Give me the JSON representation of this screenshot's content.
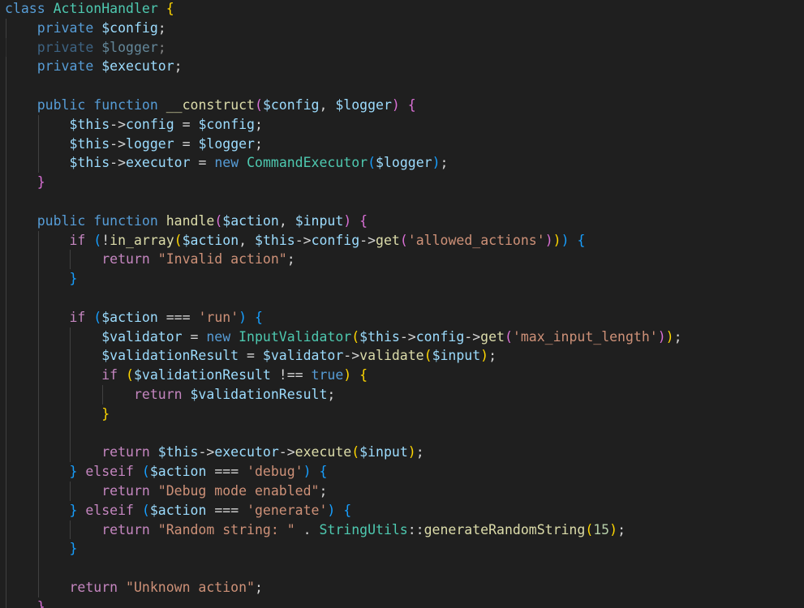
{
  "theme": {
    "background": "#1f1f1f",
    "keyword": "#569cd6",
    "control": "#c586c0",
    "class_name": "#4ec9b0",
    "function_name": "#dcdcaa",
    "variable": "#9cdcfe",
    "string": "#ce9178",
    "number": "#b5cea8",
    "punctuation": "#d4d4d4",
    "bracket_1": "#ffd700",
    "bracket_2": "#da70d6",
    "bracket_3": "#179fff"
  },
  "code": {
    "lines": [
      {
        "indent": 0,
        "tokens": [
          [
            "class",
            "kw"
          ],
          [
            " ",
            "pun"
          ],
          [
            "ActionHandler",
            "cls"
          ],
          [
            " ",
            "pun"
          ],
          [
            "{",
            "b1"
          ]
        ]
      },
      {
        "indent": 1,
        "tokens": [
          [
            "private",
            "kw"
          ],
          [
            " ",
            "pun"
          ],
          [
            "$config",
            "var"
          ],
          [
            ";",
            "pun"
          ]
        ]
      },
      {
        "indent": 1,
        "dim": true,
        "tokens": [
          [
            "private",
            "kw"
          ],
          [
            " ",
            "pun"
          ],
          [
            "$logger",
            "var"
          ],
          [
            ";",
            "pun"
          ]
        ]
      },
      {
        "indent": 1,
        "tokens": [
          [
            "private",
            "kw"
          ],
          [
            " ",
            "pun"
          ],
          [
            "$executor",
            "var"
          ],
          [
            ";",
            "pun"
          ]
        ]
      },
      {
        "indent": 1,
        "tokens": []
      },
      {
        "indent": 1,
        "tokens": [
          [
            "public",
            "kw"
          ],
          [
            " ",
            "pun"
          ],
          [
            "function",
            "kw"
          ],
          [
            " ",
            "pun"
          ],
          [
            "__construct",
            "fn"
          ],
          [
            "(",
            "b2"
          ],
          [
            "$config",
            "var"
          ],
          [
            ", ",
            "pun"
          ],
          [
            "$logger",
            "var"
          ],
          [
            ")",
            "b2"
          ],
          [
            " ",
            "pun"
          ],
          [
            "{",
            "b2"
          ]
        ]
      },
      {
        "indent": 2,
        "tokens": [
          [
            "$this",
            "var"
          ],
          [
            "->",
            "pun"
          ],
          [
            "config",
            "var"
          ],
          [
            " = ",
            "pun"
          ],
          [
            "$config",
            "var"
          ],
          [
            ";",
            "pun"
          ]
        ]
      },
      {
        "indent": 2,
        "tokens": [
          [
            "$this",
            "var"
          ],
          [
            "->",
            "pun"
          ],
          [
            "logger",
            "var"
          ],
          [
            " = ",
            "pun"
          ],
          [
            "$logger",
            "var"
          ],
          [
            ";",
            "pun"
          ]
        ]
      },
      {
        "indent": 2,
        "tokens": [
          [
            "$this",
            "var"
          ],
          [
            "->",
            "pun"
          ],
          [
            "executor",
            "var"
          ],
          [
            " = ",
            "pun"
          ],
          [
            "new",
            "kw"
          ],
          [
            " ",
            "pun"
          ],
          [
            "CommandExecutor",
            "cls"
          ],
          [
            "(",
            "b3"
          ],
          [
            "$logger",
            "var"
          ],
          [
            ")",
            "b3"
          ],
          [
            ";",
            "pun"
          ]
        ]
      },
      {
        "indent": 1,
        "tokens": [
          [
            "}",
            "b2"
          ]
        ]
      },
      {
        "indent": 1,
        "tokens": []
      },
      {
        "indent": 1,
        "tokens": [
          [
            "public",
            "kw"
          ],
          [
            " ",
            "pun"
          ],
          [
            "function",
            "kw"
          ],
          [
            " ",
            "pun"
          ],
          [
            "handle",
            "fn"
          ],
          [
            "(",
            "b2"
          ],
          [
            "$action",
            "var"
          ],
          [
            ", ",
            "pun"
          ],
          [
            "$input",
            "var"
          ],
          [
            ")",
            "b2"
          ],
          [
            " ",
            "pun"
          ],
          [
            "{",
            "b2"
          ]
        ]
      },
      {
        "indent": 2,
        "tokens": [
          [
            "if",
            "ctl"
          ],
          [
            " ",
            "pun"
          ],
          [
            "(",
            "b3"
          ],
          [
            "!",
            "pun"
          ],
          [
            "in_array",
            "fn"
          ],
          [
            "(",
            "b1"
          ],
          [
            "$action",
            "var"
          ],
          [
            ", ",
            "pun"
          ],
          [
            "$this",
            "var"
          ],
          [
            "->",
            "pun"
          ],
          [
            "config",
            "var"
          ],
          [
            "->",
            "pun"
          ],
          [
            "get",
            "fn"
          ],
          [
            "(",
            "b2"
          ],
          [
            "'allowed_actions'",
            "str"
          ],
          [
            ")",
            "b2"
          ],
          [
            ")",
            "b1"
          ],
          [
            ")",
            "b3"
          ],
          [
            " ",
            "pun"
          ],
          [
            "{",
            "b3"
          ]
        ]
      },
      {
        "indent": 3,
        "tokens": [
          [
            "return",
            "ctl"
          ],
          [
            " ",
            "pun"
          ],
          [
            "\"Invalid action\"",
            "str"
          ],
          [
            ";",
            "pun"
          ]
        ]
      },
      {
        "indent": 2,
        "tokens": [
          [
            "}",
            "b3"
          ]
        ]
      },
      {
        "indent": 2,
        "tokens": []
      },
      {
        "indent": 2,
        "tokens": [
          [
            "if",
            "ctl"
          ],
          [
            " ",
            "pun"
          ],
          [
            "(",
            "b3"
          ],
          [
            "$action",
            "var"
          ],
          [
            " === ",
            "pun"
          ],
          [
            "'run'",
            "str"
          ],
          [
            ")",
            "b3"
          ],
          [
            " ",
            "pun"
          ],
          [
            "{",
            "b3"
          ]
        ]
      },
      {
        "indent": 3,
        "tokens": [
          [
            "$validator",
            "var"
          ],
          [
            " = ",
            "pun"
          ],
          [
            "new",
            "kw"
          ],
          [
            " ",
            "pun"
          ],
          [
            "InputValidator",
            "cls"
          ],
          [
            "(",
            "b1"
          ],
          [
            "$this",
            "var"
          ],
          [
            "->",
            "pun"
          ],
          [
            "config",
            "var"
          ],
          [
            "->",
            "pun"
          ],
          [
            "get",
            "fn"
          ],
          [
            "(",
            "b2"
          ],
          [
            "'max_input_length'",
            "str"
          ],
          [
            ")",
            "b2"
          ],
          [
            ")",
            "b1"
          ],
          [
            ";",
            "pun"
          ]
        ]
      },
      {
        "indent": 3,
        "tokens": [
          [
            "$validationResult",
            "var"
          ],
          [
            " = ",
            "pun"
          ],
          [
            "$validator",
            "var"
          ],
          [
            "->",
            "pun"
          ],
          [
            "validate",
            "fn"
          ],
          [
            "(",
            "b1"
          ],
          [
            "$input",
            "var"
          ],
          [
            ")",
            "b1"
          ],
          [
            ";",
            "pun"
          ]
        ]
      },
      {
        "indent": 3,
        "tokens": [
          [
            "if",
            "ctl"
          ],
          [
            " ",
            "pun"
          ],
          [
            "(",
            "b1"
          ],
          [
            "$validationResult",
            "var"
          ],
          [
            " !== ",
            "pun"
          ],
          [
            "true",
            "kw"
          ],
          [
            ")",
            "b1"
          ],
          [
            " ",
            "pun"
          ],
          [
            "{",
            "b1"
          ]
        ]
      },
      {
        "indent": 4,
        "tokens": [
          [
            "return",
            "ctl"
          ],
          [
            " ",
            "pun"
          ],
          [
            "$validationResult",
            "var"
          ],
          [
            ";",
            "pun"
          ]
        ]
      },
      {
        "indent": 3,
        "tokens": [
          [
            "}",
            "b1"
          ]
        ]
      },
      {
        "indent": 3,
        "tokens": []
      },
      {
        "indent": 3,
        "tokens": [
          [
            "return",
            "ctl"
          ],
          [
            " ",
            "pun"
          ],
          [
            "$this",
            "var"
          ],
          [
            "->",
            "pun"
          ],
          [
            "executor",
            "var"
          ],
          [
            "->",
            "pun"
          ],
          [
            "execute",
            "fn"
          ],
          [
            "(",
            "b1"
          ],
          [
            "$input",
            "var"
          ],
          [
            ")",
            "b1"
          ],
          [
            ";",
            "pun"
          ]
        ]
      },
      {
        "indent": 2,
        "tokens": [
          [
            "}",
            "b3"
          ],
          [
            " ",
            "pun"
          ],
          [
            "elseif",
            "ctl"
          ],
          [
            " ",
            "pun"
          ],
          [
            "(",
            "b3"
          ],
          [
            "$action",
            "var"
          ],
          [
            " === ",
            "pun"
          ],
          [
            "'debug'",
            "str"
          ],
          [
            ")",
            "b3"
          ],
          [
            " ",
            "pun"
          ],
          [
            "{",
            "b3"
          ]
        ]
      },
      {
        "indent": 3,
        "tokens": [
          [
            "return",
            "ctl"
          ],
          [
            " ",
            "pun"
          ],
          [
            "\"Debug mode enabled\"",
            "str"
          ],
          [
            ";",
            "pun"
          ]
        ]
      },
      {
        "indent": 2,
        "tokens": [
          [
            "}",
            "b3"
          ],
          [
            " ",
            "pun"
          ],
          [
            "elseif",
            "ctl"
          ],
          [
            " ",
            "pun"
          ],
          [
            "(",
            "b3"
          ],
          [
            "$action",
            "var"
          ],
          [
            " === ",
            "pun"
          ],
          [
            "'generate'",
            "str"
          ],
          [
            ")",
            "b3"
          ],
          [
            " ",
            "pun"
          ],
          [
            "{",
            "b3"
          ]
        ]
      },
      {
        "indent": 3,
        "tokens": [
          [
            "return",
            "ctl"
          ],
          [
            " ",
            "pun"
          ],
          [
            "\"Random string: \"",
            "str"
          ],
          [
            " . ",
            "pun"
          ],
          [
            "StringUtils",
            "cls"
          ],
          [
            "::",
            "pun"
          ],
          [
            "generateRandomString",
            "fn"
          ],
          [
            "(",
            "b1"
          ],
          [
            "15",
            "num"
          ],
          [
            ")",
            "b1"
          ],
          [
            ";",
            "pun"
          ]
        ]
      },
      {
        "indent": 2,
        "tokens": [
          [
            "}",
            "b3"
          ]
        ]
      },
      {
        "indent": 2,
        "tokens": []
      },
      {
        "indent": 2,
        "tokens": [
          [
            "return",
            "ctl"
          ],
          [
            " ",
            "pun"
          ],
          [
            "\"Unknown action\"",
            "str"
          ],
          [
            ";",
            "pun"
          ]
        ]
      },
      {
        "indent": 1,
        "tokens": [
          [
            "}",
            "b2"
          ]
        ]
      }
    ]
  }
}
